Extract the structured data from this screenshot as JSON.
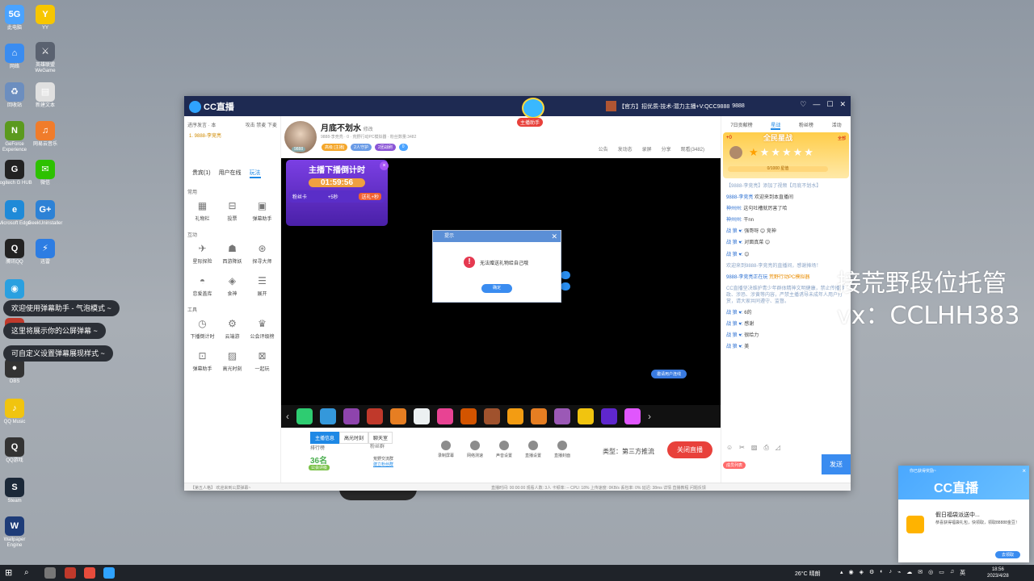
{
  "desktop": {
    "icons": [
      {
        "label": "此电脑",
        "color": "#4aa3ff",
        "glyph": "5G"
      },
      {
        "label": "网络",
        "color": "#3a8cf0",
        "glyph": "⌂"
      },
      {
        "label": "回收站",
        "color": "#6c8ebf",
        "glyph": "♻"
      },
      {
        "label": "GeForce Experience",
        "color": "#5b9a1f",
        "glyph": "N"
      },
      {
        "label": "Logitech G HUB",
        "color": "#222222",
        "glyph": "G"
      },
      {
        "label": "Microsoft Edge",
        "color": "#1f8ad8",
        "glyph": "e"
      },
      {
        "label": "腾讯QQ",
        "color": "#222222",
        "glyph": "Q"
      },
      {
        "label": "",
        "color": "#2aa0e0",
        "glyph": "◉"
      },
      {
        "label": "",
        "color": "#c0392b",
        "glyph": "◆"
      },
      {
        "label": "OBS",
        "color": "#333333",
        "glyph": "●"
      },
      {
        "label": "QQ Music",
        "color": "#f1c40f",
        "glyph": "♪"
      },
      {
        "label": "QQ游戏",
        "color": "#333333",
        "glyph": "Q"
      },
      {
        "label": "Steam",
        "color": "#1b2838",
        "glyph": "S"
      },
      {
        "label": "Wallpaper Engine",
        "color": "#1e3c78",
        "glyph": "W"
      }
    ],
    "icons_col2": [
      {
        "label": "YY",
        "color": "#f7c600",
        "glyph": "Y"
      },
      {
        "label": "英雄联盟WeGame",
        "color": "#5a6270",
        "glyph": "⚔"
      },
      {
        "label": "新建文本",
        "color": "#e0e0e0",
        "glyph": "▤"
      },
      {
        "label": "网易云音乐",
        "color": "#f07c2b",
        "glyph": "♫"
      },
      {
        "label": "微信",
        "color": "#2dc100",
        "glyph": "✉"
      },
      {
        "label": "GeekUninstaller",
        "color": "#2d82d6",
        "glyph": "G+"
      },
      {
        "label": "迅雷",
        "color": "#2d7de3",
        "glyph": "⚡"
      }
    ]
  },
  "danmu_bubbles": [
    "欢迎使用弹幕助手 - 气泡模式 ~",
    "这里将展示你的公屏弹幕 ~",
    "可自定义设置弹幕展现样式 ~"
  ],
  "watermark": {
    "line1": "接荒野段位托管",
    "line2": "vx：CCLHH383"
  },
  "window": {
    "app_name": "CC直播",
    "mascot_tag": "主播助手",
    "anchor_bar": "【官方】招优质-技术-潜力主播+V:QCC9888",
    "anchor_bar_id": "9888",
    "controls": [
      "♡",
      "—",
      "☐",
      "✕"
    ],
    "left": {
      "head_left": "进序发言 · 本",
      "head_right": "攻击 禁麦 下麦",
      "rank_item": "1. 9888-李竞亮",
      "tabs": [
        {
          "label": "贵宾(1)",
          "on": false
        },
        {
          "label": "用户在线",
          "on": false
        },
        {
          "label": "玩法",
          "on": true
        }
      ],
      "sections": [
        {
          "title": "常用",
          "tools": [
            {
              "label": "礼物栏",
              "icon": "gift-icon",
              "glyph": "▦"
            },
            {
              "label": "投票",
              "icon": "vote-icon",
              "glyph": "⊟"
            },
            {
              "label": "弹幕助手",
              "icon": "danmu-icon",
              "glyph": "▣"
            }
          ]
        },
        {
          "title": "互动",
          "tools": [
            {
              "label": "星际探险",
              "icon": "rocket-icon",
              "glyph": "✈"
            },
            {
              "label": "西游降妖",
              "icon": "game-icon",
              "glyph": "☗"
            },
            {
              "label": "探寻大师",
              "icon": "search-icon",
              "glyph": "⊛"
            },
            {
              "label": "恋爱盖库",
              "icon": "heart-icon",
              "glyph": "◓"
            },
            {
              "label": "食神",
              "icon": "chef-icon",
              "glyph": "◈"
            },
            {
              "label": "展开",
              "icon": "expand-icon",
              "glyph": "☰"
            }
          ]
        },
        {
          "title": "工具",
          "tools": [
            {
              "label": "下播倒计时",
              "icon": "timer-icon",
              "glyph": "◷"
            },
            {
              "label": "云端游",
              "icon": "cloud-icon",
              "glyph": "⚙"
            },
            {
              "label": "公会评级榜",
              "icon": "crown-icon",
              "glyph": "♛"
            },
            {
              "label": "弹幕助手",
              "icon": "danmu2-icon",
              "glyph": "⊡"
            },
            {
              "label": "高光时刻",
              "icon": "image-icon",
              "glyph": "▨"
            },
            {
              "label": "一起玩",
              "icon": "play-icon",
              "glyph": "⊠"
            }
          ]
        }
      ]
    },
    "anchor": {
      "name": "月底不划水",
      "edit": "修改",
      "id": "9888",
      "sub": "9888-李竞亮  ·  0  ·  荒野行动PC模拟器  ·  粉丝数量:3482",
      "badges": [
        {
          "text": "高级 [主播]",
          "color": "#f4a62a"
        },
        {
          "text": "2人守护",
          "color": "#6a9be6"
        },
        {
          "text": "2团战刷",
          "color": "#8a55d6"
        },
        {
          "text": "0",
          "color": "#4aa3ff"
        }
      ],
      "actions": [
        "公告",
        "发动态",
        "录屏",
        "分享",
        "观看(3482)"
      ]
    },
    "countdown": {
      "title": "主播下播倒计时",
      "time": "01:59:56",
      "card_label": "粉丝卡",
      "card_plus": "+5秒",
      "card_btn": "送礼+秒"
    },
    "invite_btn": "邀请用户连线",
    "bottom": {
      "tabs": [
        {
          "label": "主播信息",
          "on": true
        },
        {
          "label": "高光时刻",
          "on": false
        },
        {
          "label": "聊天室",
          "on": false
        }
      ],
      "rank_label": "排行榜",
      "fans_label": "粉丝群",
      "rank_value": "36名",
      "rank_tag": "公会评级",
      "group_line1": "荒野交流群",
      "group_link": "建立粉丝群",
      "controls": [
        {
          "label": "录制屏幕",
          "icon": "record-icon"
        },
        {
          "label": "网络测速",
          "icon": "speed-icon"
        },
        {
          "label": "声音设置",
          "icon": "sound-icon"
        },
        {
          "label": "直播设置",
          "icon": "settings-icon"
        },
        {
          "label": "直播封面",
          "icon": "camera-icon"
        }
      ],
      "type_label": "类型：第三方推流",
      "live_btn": "关闭直播"
    },
    "right": {
      "tabs": [
        {
          "label": "7日贡献榜",
          "on": false
        },
        {
          "label": "星战",
          "on": true
        },
        {
          "label": "粉丝榜",
          "on": false
        },
        {
          "label": "活动",
          "on": false
        }
      ],
      "star_title": "全民星战",
      "star_left": "+0",
      "star_right": "全部",
      "star_bar": "0/1000 星值",
      "chat": [
        {
          "type": "sys",
          "user": "",
          "text": "【9888-李竞亮】添加了视频【月底不划水】"
        },
        {
          "type": "msg",
          "user": "9888-李竞亮",
          "text": "欢迎来到本直播间"
        },
        {
          "type": "msg",
          "user": "神州州:",
          "text": "这句吐槽就厉害了哈"
        },
        {
          "type": "msg",
          "user": "神州州:",
          "text": "干nn"
        },
        {
          "type": "msg",
          "user": "战 狼 ♥:",
          "text": "强哥呀 😊 竞神"
        },
        {
          "type": "msg",
          "user": "战 狼 ♥:",
          "text": "对面真菜 😊"
        },
        {
          "type": "msg",
          "user": "战 狼 ♥:",
          "text": "😊"
        },
        {
          "type": "sys",
          "user": "",
          "text": "欢迎来到9888-李竞亮的直播间，感谢捧场！"
        },
        {
          "type": "hl",
          "user": "9888-李竞亮正在玩",
          "text": "荒野行动PC模拟器"
        },
        {
          "type": "sys",
          "user": "",
          "text": "CC直播坚决维护青少年群体精神文明健康，禁止传播涉政、涉恐、涉黄等内容，严禁主播诱导未成年人用户打赏，请大家共同遵守、监督。"
        },
        {
          "type": "msg",
          "user": "战 狼 ♥:",
          "text": "6的"
        },
        {
          "type": "msg",
          "user": "战 狼 ♥:",
          "text": "感谢"
        },
        {
          "type": "msg",
          "user": "战 狼 ♥:",
          "text": "很给力"
        },
        {
          "type": "msg",
          "user": "战 狼 ♥:",
          "text": "美"
        }
      ],
      "chat_tools": [
        "☺",
        "✂",
        "▨",
        "⎙",
        "◿"
      ],
      "send": "发送",
      "red_pill": "成员列表"
    },
    "statusbar": {
      "left": "【第五人格】 欢迎来到公屏弹幕~",
      "right": "直播时间: 00:00:00    观看人数: 3人    卡顿率:  --    CPU: 18%    上传速度: 0KB/s    丢包率: 0%    延迟: 38ms    详情    直播教程    问题反馈"
    }
  },
  "dialog": {
    "title": "提示",
    "message": "无法赠送礼物给自己哦",
    "ok": "确定"
  },
  "notification": {
    "title": "你已获得奖励~",
    "logo": "CC直播",
    "heading": "假日福袋派送中...",
    "body": "恭喜获得福袋礼包，快领取，领取88888金豆！",
    "btn": "去领取"
  },
  "taskbar": {
    "weather": "26°C  晴朗",
    "lang": "英",
    "time": "18:56",
    "date": "2023/4/28"
  }
}
